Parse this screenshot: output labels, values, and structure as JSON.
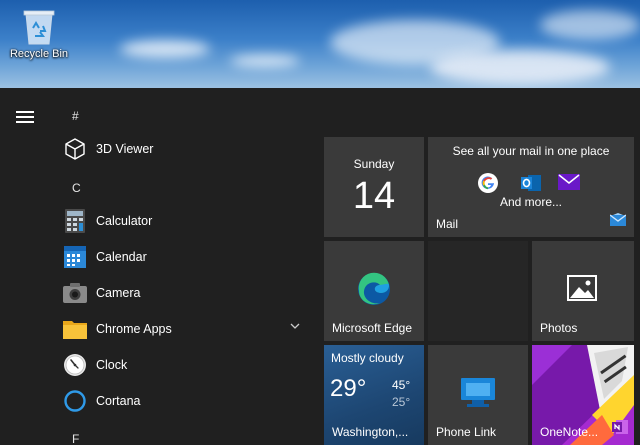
{
  "desktop": {
    "recycle_bin_label": "Recycle Bin"
  },
  "menu": {
    "hamburger": "hamburger-icon"
  },
  "applist": {
    "groups": [
      {
        "letter": "#"
      },
      {
        "letter": "C"
      },
      {
        "letter": "F"
      }
    ],
    "apps": [
      {
        "label": "3D Viewer",
        "icon": "cube-icon"
      },
      {
        "label": "Calculator",
        "icon": "calculator-icon"
      },
      {
        "label": "Calendar",
        "icon": "calendar-icon"
      },
      {
        "label": "Camera",
        "icon": "camera-icon"
      },
      {
        "label": "Chrome Apps",
        "icon": "folder-icon"
      },
      {
        "label": "Clock",
        "icon": "clock-icon"
      },
      {
        "label": "Cortana",
        "icon": "cortana-icon"
      }
    ]
  },
  "tiles": {
    "calendar": {
      "day": "Sunday",
      "date": "14"
    },
    "mail": {
      "headline": "See all your mail in one place",
      "more": "And more...",
      "label": "Mail"
    },
    "edge": {
      "label": "Microsoft Edge"
    },
    "photos": {
      "label": "Photos"
    },
    "weather": {
      "condition": "Mostly cloudy",
      "temp": "29°",
      "high": "45°",
      "low": "25°",
      "location": "Washington,..."
    },
    "phone": {
      "label": "Phone Link"
    },
    "onenote": {
      "label": "OneNote..."
    }
  },
  "colors": {
    "start_bg": "#202020",
    "tile_bg": "#3a3a3a",
    "accent": "#0078d4"
  }
}
